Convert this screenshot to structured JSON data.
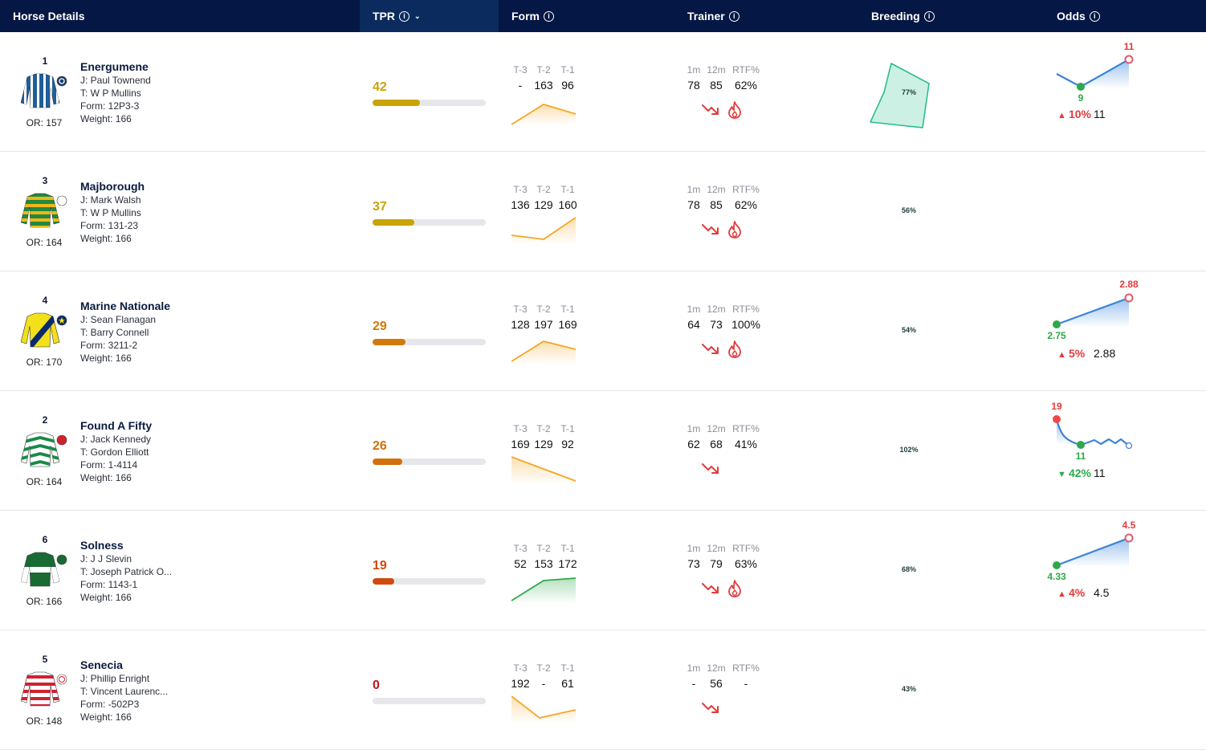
{
  "header": {
    "horse_details": "Horse Details",
    "tpr": "TPR",
    "form": "Form",
    "trainer": "Trainer",
    "breeding": "Breeding",
    "odds": "Odds"
  },
  "form_labels": [
    "T-3",
    "T-2",
    "T-1"
  ],
  "trainer_labels": [
    "1m",
    "12m",
    "RTF%"
  ],
  "rows": [
    {
      "num": "1",
      "name": "Energumene",
      "jockey": "J: Paul Townend",
      "trainer": "T: W P Mullins",
      "form": "Form: 12P3-3",
      "weight": "Weight: 166",
      "or": "OR: 157",
      "tpr": "42",
      "tpr_fraction": 0.42,
      "tpr_color": "#c9a406",
      "form_vals": [
        "-",
        "163",
        "96"
      ],
      "trend": "up",
      "trainer_vals": [
        "78",
        "85",
        "62%"
      ],
      "hot": true,
      "breeding": "77%",
      "odds": {
        "show": true,
        "open": "9",
        "last": "11",
        "change": "10%",
        "dir": "up",
        "current": "11"
      }
    },
    {
      "num": "3",
      "name": "Majborough",
      "jockey": "J: Mark Walsh",
      "trainer": "T: W P Mullins",
      "form": "Form: 131-23",
      "weight": "Weight: 166",
      "or": "OR: 164",
      "tpr": "37",
      "tpr_fraction": 0.37,
      "tpr_color": "#c9a406",
      "form_vals": [
        "136",
        "129",
        "160"
      ],
      "trend": "up",
      "trainer_vals": [
        "78",
        "85",
        "62%"
      ],
      "hot": true,
      "breeding": "56%",
      "odds": {
        "show": false
      }
    },
    {
      "num": "4",
      "name": "Marine Nationale",
      "jockey": "J: Sean Flanagan",
      "trainer": "T: Barry Connell",
      "form": "Form: 3211-2",
      "weight": "Weight: 166",
      "or": "OR: 170",
      "tpr": "29",
      "tpr_fraction": 0.29,
      "tpr_color": "#d17a0a",
      "form_vals": [
        "128",
        "197",
        "169"
      ],
      "trend": "up",
      "trainer_vals": [
        "64",
        "73",
        "100%"
      ],
      "hot": true,
      "breeding": "54%",
      "odds": {
        "show": true,
        "open": "2.75",
        "last": "2.88",
        "change": "5%",
        "dir": "up",
        "current": "2.88"
      }
    },
    {
      "num": "2",
      "name": "Found A Fifty",
      "jockey": "J: Jack Kennedy",
      "trainer": "T: Gordon Elliott",
      "form": "Form: 1-4114",
      "weight": "Weight: 166",
      "or": "OR: 164",
      "tpr": "26",
      "tpr_fraction": 0.26,
      "tpr_color": "#d1700a",
      "form_vals": [
        "169",
        "129",
        "92"
      ],
      "trend": "up",
      "trainer_vals": [
        "62",
        "68",
        "41%"
      ],
      "hot": false,
      "breeding": "102%",
      "odds": {
        "show": true,
        "open": "19",
        "last": "11",
        "change": "42%",
        "dir": "down",
        "current": "11"
      }
    },
    {
      "num": "6",
      "name": "Solness",
      "jockey": "J: J J Slevin",
      "trainer": "T: Joseph Patrick O...",
      "form": "Form: 1143-1",
      "weight": "Weight: 166",
      "or": "OR: 166",
      "tpr": "19",
      "tpr_fraction": 0.19,
      "tpr_color": "#cf4a0c",
      "form_vals": [
        "52",
        "153",
        "172"
      ],
      "trend": "up",
      "trainer_vals": [
        "73",
        "79",
        "63%"
      ],
      "hot": true,
      "breeding": "68%",
      "odds": {
        "show": true,
        "open": "4.33",
        "last": "4.5",
        "change": "4%",
        "dir": "up",
        "current": "4.5"
      }
    },
    {
      "num": "5",
      "name": "Senecia",
      "jockey": "J: Phillip Enright",
      "trainer": "T: Vincent Laurenc...",
      "form": "Form: -502P3",
      "weight": "Weight: 166",
      "or": "OR: 148",
      "tpr": "0",
      "tpr_fraction": 0,
      "tpr_color": "#c0141a",
      "form_vals": [
        "192",
        "-",
        "61"
      ],
      "trend": "up",
      "trainer_vals": [
        "-",
        "56",
        "-"
      ],
      "hot": false,
      "breeding": "43%",
      "odds": {
        "show": false
      }
    }
  ]
}
